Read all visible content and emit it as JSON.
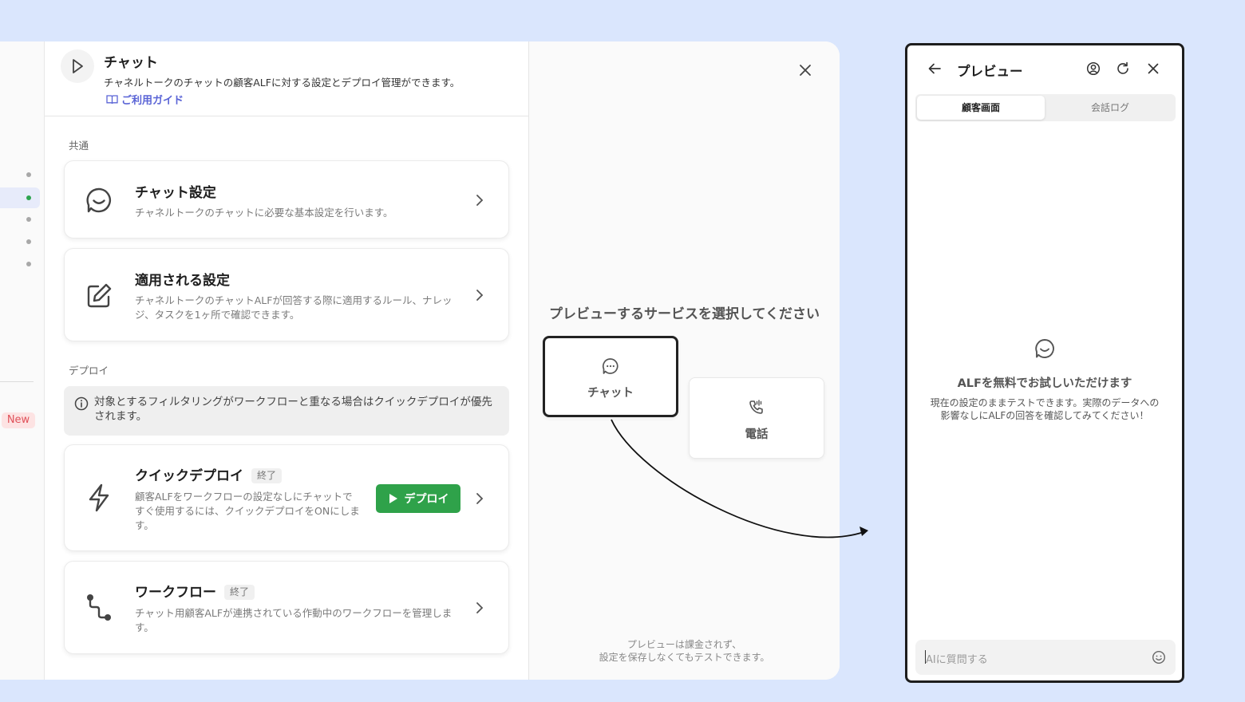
{
  "header": {
    "title": "チャット",
    "description": "チャネルトークのチャットの顧客ALFに対する設定とデプロイ管理ができます。",
    "guide_link": "ご利用ガイド"
  },
  "sidebar": {
    "new_badge": "New"
  },
  "sections": {
    "common": "共通",
    "deploy": "デプロイ"
  },
  "cards": {
    "chat_settings": {
      "title": "チャット設定",
      "description": "チャネルトークのチャットに必要な基本設定を行います。",
      "icon": "chat-bubble-icon"
    },
    "applied_settings": {
      "title": "適用される設定",
      "description": "チャネルトークのチャットALFが回答する際に適用するルール、ナレッジ、タスクを1ヶ所で確認できます。",
      "icon": "edit-icon"
    },
    "quick_deploy": {
      "title": "クイックデプロイ",
      "status": "終了",
      "description": "顧客ALFをワークフローの設定なしにチャットですぐ使用するには、クイックデプロイをONにします。",
      "button": "デプロイ",
      "icon": "lightning-icon"
    },
    "workflow": {
      "title": "ワークフロー",
      "status": "終了",
      "description": "チャット用顧客ALFが連携されている作動中のワークフローを管理します。",
      "icon": "workflow-icon"
    }
  },
  "info": {
    "text": "対象とするフィルタリングがワークフローと重なる場合はクイックデプロイが優先されます。"
  },
  "chooser": {
    "title": "プレビューするサービスを選択してください",
    "options": [
      {
        "label": "チャット",
        "icon": "chat-dots-icon",
        "selected": true
      },
      {
        "label": "電話",
        "icon": "phone-icon",
        "selected": false
      }
    ],
    "note_line1": "プレビューは課金されず、",
    "note_line2": "設定を保存しなくてもテストできます。"
  },
  "preview": {
    "title": "プレビュー",
    "tabs": [
      "顧客画面",
      "会話ログ"
    ],
    "active_tab": "顧客画面",
    "empty_title": "ALFを無料でお試しいただけます",
    "empty_description": "現在の設定のままテストできます。実際のデータへの影響なしにALFの回答を確認してみてください！",
    "input_placeholder": "AIに質問する"
  },
  "colors": {
    "background": "#dae6fd",
    "accent_green": "#2fa24a",
    "link": "#5a64d6",
    "badge_red": "#e0525a"
  }
}
